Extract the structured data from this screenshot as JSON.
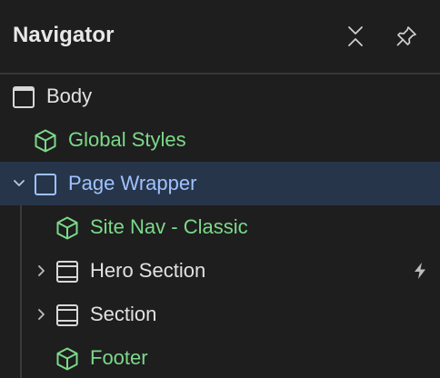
{
  "header": {
    "title": "Navigator",
    "collapse_icon": "collapse-all-icon",
    "pin_icon": "pin-icon"
  },
  "tree": {
    "items": [
      {
        "label": "Body",
        "icon": "element-box-icon",
        "kind": "element",
        "expander": "none",
        "selected": false
      },
      {
        "label": "Global Styles",
        "icon": "component-icon",
        "kind": "component",
        "expander": "none",
        "selected": false
      },
      {
        "label": "Page Wrapper",
        "icon": "element-box-icon",
        "kind": "element",
        "expander": "chevron-down",
        "selected": true
      },
      {
        "label": "Site Nav - Classic",
        "icon": "component-icon",
        "kind": "component",
        "expander": "none",
        "selected": false
      },
      {
        "label": "Hero Section",
        "icon": "section-icon",
        "kind": "element",
        "expander": "chevron-right",
        "selected": false,
        "badge": "interaction-bolt-icon"
      },
      {
        "label": "Section",
        "icon": "section-icon",
        "kind": "element",
        "expander": "chevron-right",
        "selected": false
      },
      {
        "label": "Footer",
        "icon": "component-icon",
        "kind": "component",
        "expander": "none",
        "selected": false
      }
    ]
  },
  "colors": {
    "background": "#1e1e1e",
    "text": "#e2e2e2",
    "component_green": "#7bd98a",
    "selected_blue_text": "#9fc2ff",
    "selected_row_bg": "#27354a"
  }
}
